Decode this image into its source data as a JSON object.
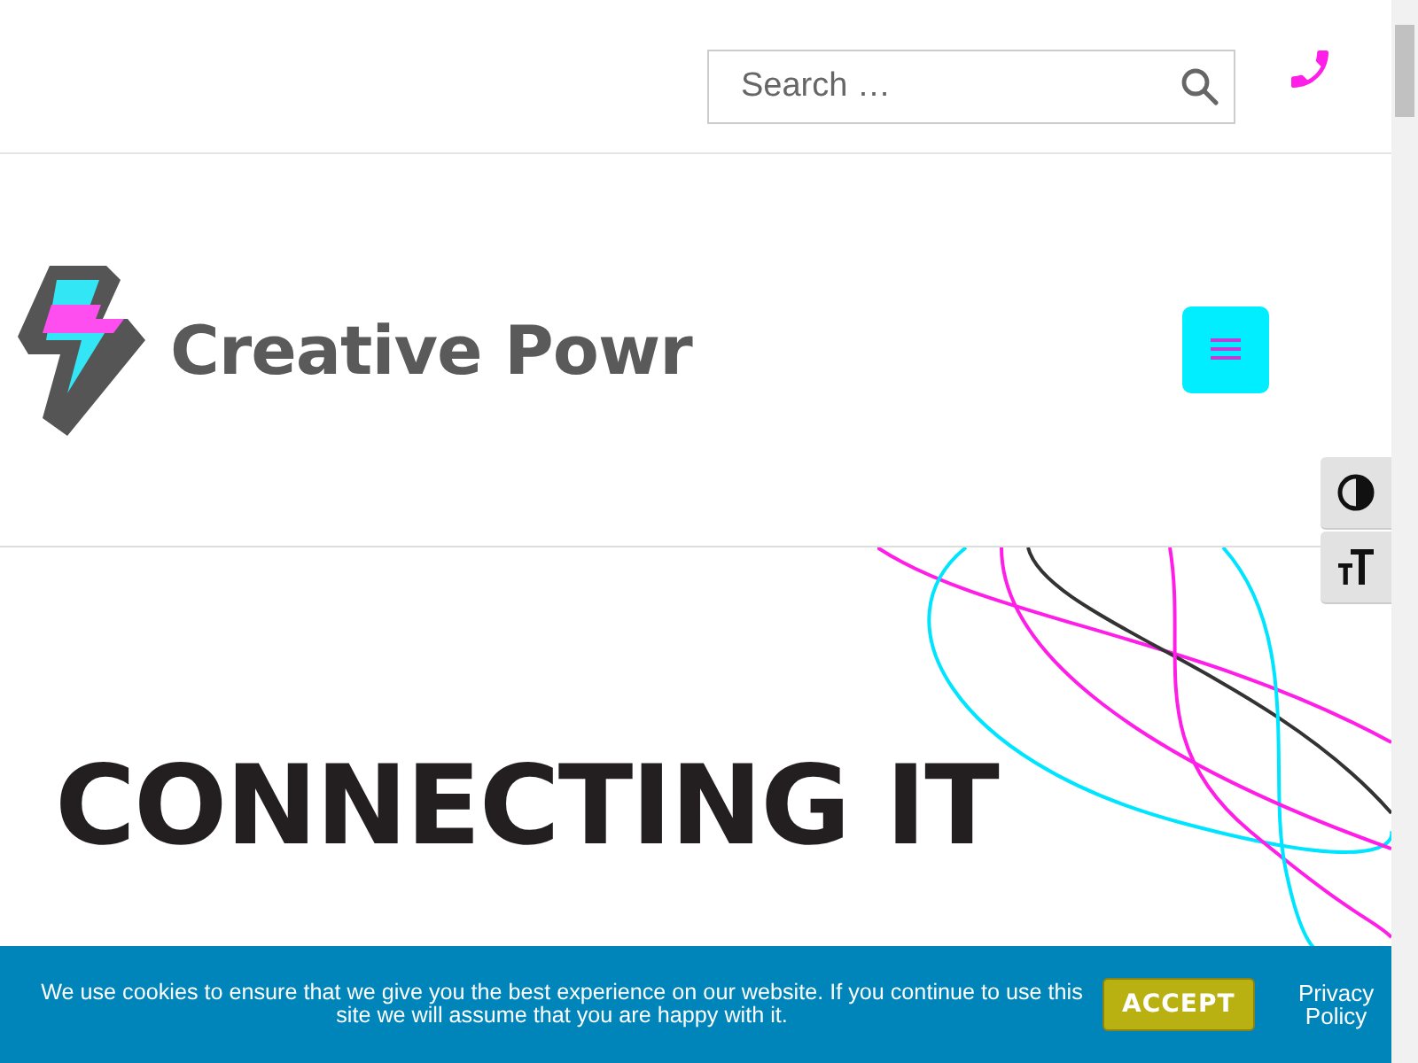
{
  "top_bar": {
    "search": {
      "placeholder": "Search …"
    }
  },
  "header": {
    "logo_text": "Creative Powr"
  },
  "hero": {
    "heading_lines": [
      "CONNECTING IT"
    ]
  },
  "cookie_banner": {
    "message": "We use cookies to ensure that we give you the best experience on our website. If you continue to use this site we will assume that you are happy with it.",
    "accept": "ACCEPT",
    "privacy_link": "Privacy Policy"
  }
}
